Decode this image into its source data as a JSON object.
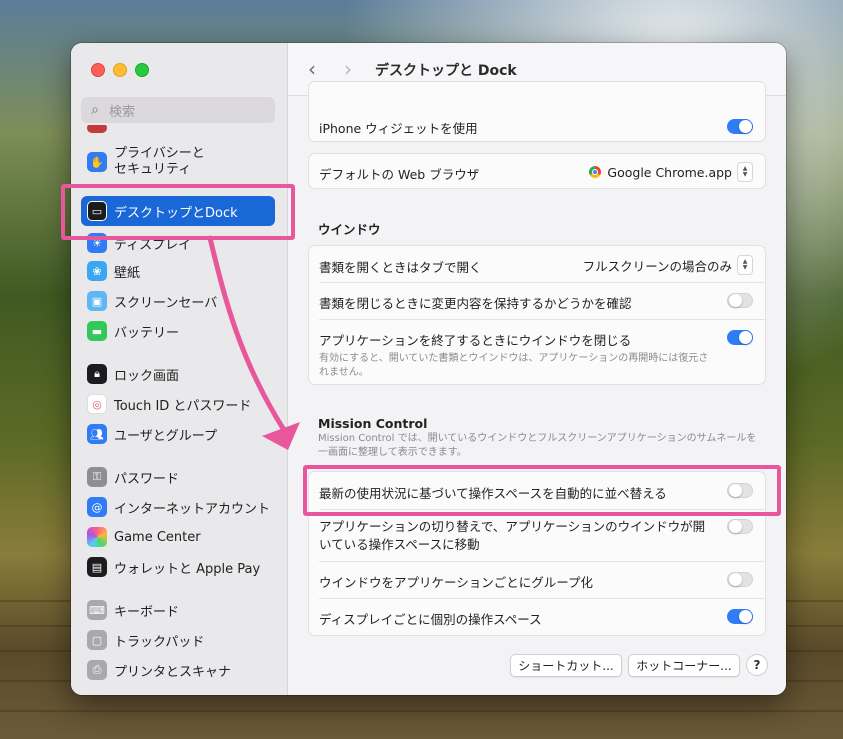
{
  "colors": {
    "accent": "#1a67d8",
    "toggle_on": "#2f7cf6",
    "annotation": "#e8579b"
  },
  "sidebar": {
    "search_placeholder": "検索",
    "items": [
      {
        "label": "プライバシーと\nセキュリティ",
        "icon": "hand-icon",
        "color": "#2f7cf6"
      },
      {
        "label": "デスクトップとDock",
        "icon": "dock-icon",
        "color": "#1c1c1e",
        "selected": true
      },
      {
        "label": "ディスプレイ",
        "icon": "sun-icon",
        "color": "#2f7cf6"
      },
      {
        "label": "壁紙",
        "icon": "flower-icon",
        "color": "#3aa7f0"
      },
      {
        "label": "スクリーンセーバ",
        "icon": "screensaver-icon",
        "color": "#5fb6f2"
      },
      {
        "label": "バッテリー",
        "icon": "battery-icon",
        "color": "#34c759"
      },
      {
        "label": "ロック画面",
        "icon": "lock-icon",
        "color": "#1c1c1e"
      },
      {
        "label": "Touch ID とパスワード",
        "icon": "fingerprint-icon",
        "color": "#f2f2f2"
      },
      {
        "label": "ユーザとグループ",
        "icon": "users-icon",
        "color": "#2f7cf6"
      },
      {
        "label": "パスワード",
        "icon": "key-icon",
        "color": "#8e8e93"
      },
      {
        "label": "インターネットアカウント",
        "icon": "at-icon",
        "color": "#2f7cf6"
      },
      {
        "label": "Game Center",
        "icon": "gamecenter-icon",
        "color": "#ffffff"
      },
      {
        "label": "ウォレットと Apple Pay",
        "icon": "wallet-icon",
        "color": "#1c1c1e"
      },
      {
        "label": "キーボード",
        "icon": "keyboard-icon",
        "color": "#a8a8ad"
      },
      {
        "label": "トラックパッド",
        "icon": "trackpad-icon",
        "color": "#a8a8ad"
      },
      {
        "label": "プリンタとスキャナ",
        "icon": "printer-icon",
        "color": "#a8a8ad"
      }
    ]
  },
  "header": {
    "title": "デスクトップと Dock",
    "back": "‹",
    "forward": "›"
  },
  "content": {
    "iphone_widget": "iPhone ウィジェットを使用",
    "default_browser_label": "デフォルトの Web ブラウザ",
    "default_browser_value": "Google Chrome.app",
    "window_section": "ウインドウ",
    "open_in_tabs_label": "書類を開くときはタブで開く",
    "open_in_tabs_value": "フルスクリーンの場合のみ",
    "ask_keep_changes": "書類を閉じるときに変更内容を保持するかどうかを確認",
    "close_windows_label": "アプリケーションを終了するときにウインドウを閉じる",
    "close_windows_desc": "有効にすると、開いていた書類とウインドウは、アプリケーションの再開時には復元されません。",
    "mission_section": "Mission Control",
    "mission_desc": "Mission Control では、開いているウインドウとフルスクリーンアプリケーションのサムネールを一画面に整理して表示できます。",
    "auto_rearrange": "最新の使用状況に基づいて操作スペースを自動的に並べ替える",
    "switch_space": "アプリケーションの切り替えで、アプリケーションのウインドウが開いている操作スペースに移動",
    "group_by_app": "ウインドウをアプリケーションごとにグループ化",
    "separate_spaces": "ディスプレイごとに個別の操作スペース"
  },
  "footer": {
    "shortcuts": "ショートカット...",
    "hot_corners": "ホットコーナー...",
    "help": "?"
  }
}
